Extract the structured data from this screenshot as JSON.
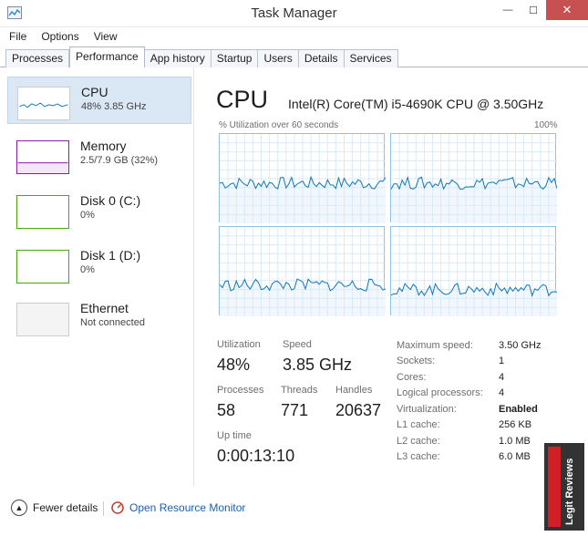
{
  "window": {
    "title": "Task Manager",
    "minimize": "—",
    "maximize": "☐",
    "close": "✕"
  },
  "menu": [
    "File",
    "Options",
    "View"
  ],
  "tabs": [
    {
      "label": "Processes"
    },
    {
      "label": "Performance",
      "active": true
    },
    {
      "label": "App history"
    },
    {
      "label": "Startup"
    },
    {
      "label": "Users"
    },
    {
      "label": "Details"
    },
    {
      "label": "Services"
    }
  ],
  "sidebar": {
    "items": [
      {
        "title": "CPU",
        "subtitle": "48% 3.85 GHz",
        "color": "#1177bb",
        "selected": true
      },
      {
        "title": "Memory",
        "subtitle": "2.5/7.9 GB (32%)",
        "color": "#8b1ba8"
      },
      {
        "title": "Disk 0 (C:)",
        "subtitle": "0%",
        "color": "#4da60c"
      },
      {
        "title": "Disk 1 (D:)",
        "subtitle": "0%",
        "color": "#4da60c"
      },
      {
        "title": "Ethernet",
        "subtitle": "Not connected",
        "color": "#cccccc"
      }
    ]
  },
  "cpu": {
    "title": "CPU",
    "model": "Intel(R) Core(TM) i5-4690K CPU @ 3.50GHz",
    "graph_label": "% Utilization over 60 seconds",
    "graph_max": "100%",
    "graph_color": "#1177bb",
    "core_levels": [
      0.45,
      0.45,
      0.35,
      0.3
    ]
  },
  "stats": {
    "utilization": {
      "label": "Utilization",
      "value": "48%"
    },
    "speed": {
      "label": "Speed",
      "value": "3.85 GHz"
    },
    "processes": {
      "label": "Processes",
      "value": "58"
    },
    "threads": {
      "label": "Threads",
      "value": "771"
    },
    "handles": {
      "label": "Handles",
      "value": "20637"
    },
    "uptime": {
      "label": "Up time",
      "value": "0:00:13:10"
    }
  },
  "specs": [
    {
      "label": "Maximum speed:",
      "value": "3.50 GHz"
    },
    {
      "label": "Sockets:",
      "value": "1"
    },
    {
      "label": "Cores:",
      "value": "4"
    },
    {
      "label": "Logical processors:",
      "value": "4"
    },
    {
      "label": "Virtualization:",
      "value": "Enabled"
    },
    {
      "label": "L1 cache:",
      "value": "256 KB"
    },
    {
      "label": "L2 cache:",
      "value": "1.0 MB"
    },
    {
      "label": "L3 cache:",
      "value": "6.0 MB"
    }
  ],
  "footer": {
    "fewer_details": "Fewer details",
    "open_monitor": "Open Resource Monitor"
  },
  "brand": {
    "text": "Legit Reviews"
  }
}
